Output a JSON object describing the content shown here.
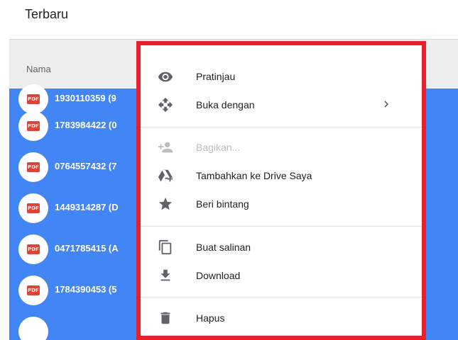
{
  "page": {
    "title": "Terbaru"
  },
  "list": {
    "column_header": "Nama",
    "files": [
      {
        "name": "1930110359 (9",
        "badge": "PDF"
      },
      {
        "name": "1783984422 (0",
        "badge": "PDF"
      },
      {
        "name": "0764557432 (7",
        "badge": "PDF"
      },
      {
        "name": "1449314287 (D",
        "badge": "PDF"
      },
      {
        "name": "0471785415 (A",
        "badge": "PDF"
      },
      {
        "name": "1784390453 (5",
        "badge": "PDF"
      }
    ]
  },
  "context_menu": {
    "items": [
      {
        "label": "Pratinjau",
        "icon": "eye-icon"
      },
      {
        "label": "Buka dengan",
        "icon": "move-arrows-icon",
        "has_submenu": true
      },
      {
        "label": "Bagikan...",
        "icon": "share-person-icon",
        "disabled": true
      },
      {
        "label": "Tambahkan ke Drive Saya",
        "icon": "drive-add-icon"
      },
      {
        "label": "Beri bintang",
        "icon": "star-icon"
      },
      {
        "label": "Buat salinan",
        "icon": "copy-icon"
      },
      {
        "label": "Download",
        "icon": "download-icon"
      },
      {
        "label": "Hapus",
        "icon": "trash-icon"
      }
    ]
  },
  "colors": {
    "selection_blue": "#4285f4",
    "highlight_red": "#e8202a",
    "pdf_red": "#db4437"
  }
}
